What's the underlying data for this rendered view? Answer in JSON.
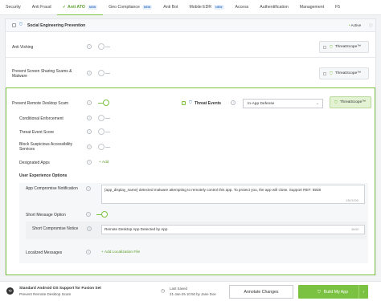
{
  "tabs": [
    {
      "label": "Security",
      "new": "",
      "active": false
    },
    {
      "label": "Anti Fraud",
      "new": "",
      "active": false
    },
    {
      "label": "Anti ATO",
      "new": "NEW",
      "active": true
    },
    {
      "label": "Geo Compliance",
      "new": "NEW",
      "active": false
    },
    {
      "label": "Anti Bot",
      "new": "",
      "active": false
    },
    {
      "label": "Mobile EDR",
      "new": "NEW",
      "active": false
    },
    {
      "label": "Access",
      "new": "",
      "active": false
    },
    {
      "label": "Authentification",
      "new": "",
      "active": false
    },
    {
      "label": "Management",
      "new": "",
      "active": false
    },
    {
      "label": "F5",
      "new": "",
      "active": false
    }
  ],
  "section": {
    "title": "Social Engineering Prevention",
    "status": "Active"
  },
  "rows": {
    "anti_vishing": {
      "label": "Anti Vishing",
      "badge": "ThreatScope™"
    },
    "screen_sharing": {
      "label": "Prevent Screen Sharing Scams & Malware",
      "badge": "ThreatScope™"
    },
    "remote_desktop": {
      "label": "Prevent Remote Desktop Scam",
      "badge": "ThreatScope™"
    }
  },
  "threat_events": {
    "label": "Threat Events",
    "select_value": "In-App Defense"
  },
  "sub_items": [
    {
      "label": "Conditional Enforcement"
    },
    {
      "label": "Threat Event Score"
    },
    {
      "label": "Block Suspicious Accessibility Services"
    },
    {
      "label": "Designated Apps"
    }
  ],
  "add_link": "+ Add",
  "ux_options_title": "User Experience Options",
  "app_compromise": {
    "label": "App Compromise Notification",
    "text": "{app_display_name} detected malware attempting to remotely control this app. To protect you, the app will close. Support REF: 6928",
    "counter": "130/1000"
  },
  "short_message_option": {
    "label": "Short Message Option"
  },
  "short_compromise": {
    "label": "Short Compromise Notice",
    "text": "Remote Desktop App Detected by App",
    "counter": "36/50"
  },
  "localized_messages": {
    "label": "Localized Messages",
    "link": "+ Add Localization File"
  },
  "footer": {
    "title": "Standard Android OS Support for Fusion Set",
    "subtitle": "Prevent Remote Desktop Scam",
    "last_saved_label": "Last Saved",
    "last_saved_value": "21-Jan-25 10:50 by Jane Doe",
    "annotate_label": "Annotate Changes",
    "build_label": "Build My App"
  },
  "colors": {
    "accent": "#7cc242",
    "accent_dark": "#5aa02c",
    "new_badge": "#3b78c7"
  },
  "icons": [
    "shield-icon",
    "info-icon",
    "check-icon",
    "chevron-down-icon",
    "arrow-right-icon",
    "history-icon"
  ]
}
